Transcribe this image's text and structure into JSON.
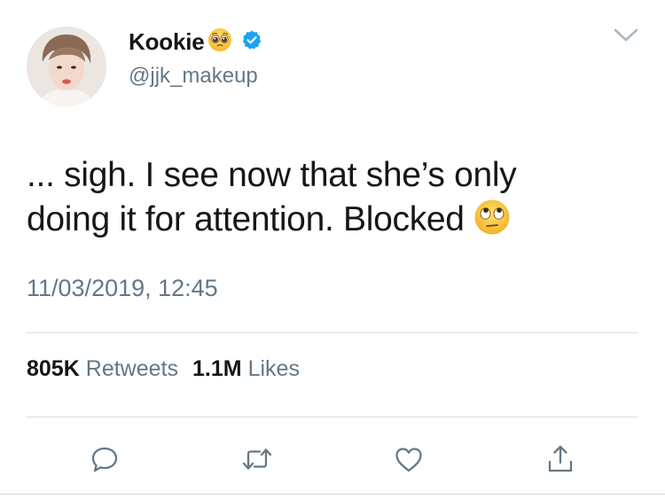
{
  "author": {
    "display_name": "Kookie",
    "name_emoji": "pleading-face-emoji",
    "verified_icon": "verified-badge-icon",
    "handle": "@jjk_makeup",
    "avatar": "profile-photo"
  },
  "tweet": {
    "text_line_1": "... sigh. I see now that she’s only",
    "text_line_2": "doing it for attention. Blocked",
    "text_emoji": "face-with-rolling-eyes-emoji",
    "timestamp": "11/03/2019, 12:45"
  },
  "stats": {
    "retweets_count": "805K",
    "retweets_label": "Retweets",
    "likes_count": "1.1M",
    "likes_label": "Likes"
  },
  "actions": {
    "reply_icon": "reply-icon",
    "retweet_icon": "retweet-icon",
    "like_icon": "heart-icon",
    "share_icon": "share-icon",
    "menu_icon": "chevron-down-icon"
  },
  "colors": {
    "text_primary": "#14171a",
    "text_secondary": "#657786",
    "verified_blue": "#1da1f2",
    "divider": "#d9dee2"
  }
}
